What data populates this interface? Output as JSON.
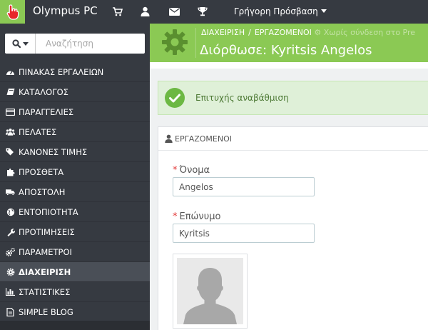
{
  "topbar": {
    "shop_name": "Olympus PC",
    "quick_access": "Γρήγορη Πρόσβαση",
    "icons": [
      "cart-icon",
      "user-icon",
      "envelope-icon",
      "trophy-icon"
    ]
  },
  "sidebar": {
    "search_placeholder": "Αναζήτηση",
    "items": [
      {
        "label": "ΠΙΝΑΚΑΣ ΕΡΓΑΛΕΙΩΝ",
        "icon": "dashboard-icon",
        "active": false
      },
      {
        "label": "ΚΑΤΑΛΟΓΟΣ",
        "icon": "book-icon",
        "active": false
      },
      {
        "label": "ΠΑΡΑΓΓΕΛΙΕΣ",
        "icon": "credit-card-icon",
        "active": false
      },
      {
        "label": "ΠΕΛΑΤΕΣ",
        "icon": "group-icon",
        "active": false
      },
      {
        "label": "ΚΑΝΟΝΕΣ ΤΙΜΗΣ",
        "icon": "tags-icon",
        "active": false
      },
      {
        "label": "ΠΡΟΣΘΕΤΑ",
        "icon": "puzzle-icon",
        "active": false
      },
      {
        "label": "ΑΠΟΣΤΟΛΗ",
        "icon": "truck-icon",
        "active": false
      },
      {
        "label": "ΕΝΤΟΠΙΟΤΗΤΑ",
        "icon": "globe-icon",
        "active": false
      },
      {
        "label": "ΠΡΟΤΙΜΗΣΕΙΣ",
        "icon": "wrench-icon",
        "active": false
      },
      {
        "label": "ΠΑΡΑΜΕΤΡΟΙ",
        "icon": "cogs-icon",
        "active": false
      },
      {
        "label": "ΔΙΑΧΕΙΡΙΣΗ",
        "icon": "cog-icon",
        "active": true
      },
      {
        "label": "ΣΤΑΤΙΣΤΙΚΕΣ",
        "icon": "bar-chart-icon",
        "active": false
      },
      {
        "label": "SIMPLE BLOG",
        "icon": "file-icon",
        "active": false
      }
    ]
  },
  "header": {
    "breadcrumb": [
      "ΔΙΑΧΕΙΡΙΣΗ",
      "ΕΡΓΑΖΟΜΕΝΟΙ"
    ],
    "breadcrumb_separator": "/",
    "breadcrumb_extra": "Χωρίς σύνδεση στο Pre",
    "title": "Διόρθωσε: Kyritsis Angelos"
  },
  "alert": {
    "text": "Επιτυχής αναβάθμιση"
  },
  "panel": {
    "heading": "ΕΡΓΑΖΟΜΕΝΟΙ",
    "required_mark": "*",
    "first_name_label": "Όνομα",
    "first_name_value": "Angelos",
    "last_name_label": "Επώνυμο",
    "last_name_value": "Kyritsis"
  },
  "colors": {
    "accent_green": "#8bc954",
    "dark_bg": "#363a41",
    "success_bg": "#dff0d8",
    "required": "#e23838"
  }
}
